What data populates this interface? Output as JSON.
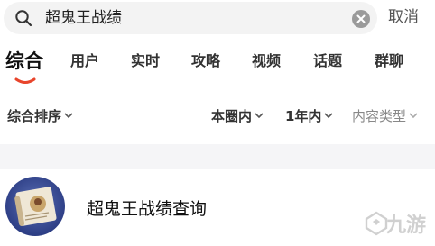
{
  "search": {
    "query": "超鬼王战绩",
    "cancel_label": "取消"
  },
  "tabs": [
    {
      "label": "综合",
      "active": true
    },
    {
      "label": "用户"
    },
    {
      "label": "实时"
    },
    {
      "label": "攻略"
    },
    {
      "label": "视频"
    },
    {
      "label": "话题"
    },
    {
      "label": "群聊"
    }
  ],
  "filters": {
    "sort": "综合排序",
    "scope": "本圈内",
    "time": "1年内",
    "content_type": "内容类型"
  },
  "results": [
    {
      "title": "超鬼王战绩查询"
    }
  ],
  "watermark": {
    "text": "九游"
  },
  "colors": {
    "accent": "#e8452c",
    "search_bg": "#f3f3f3",
    "divider_bg": "#f5f5f7",
    "muted_text": "#888888"
  }
}
